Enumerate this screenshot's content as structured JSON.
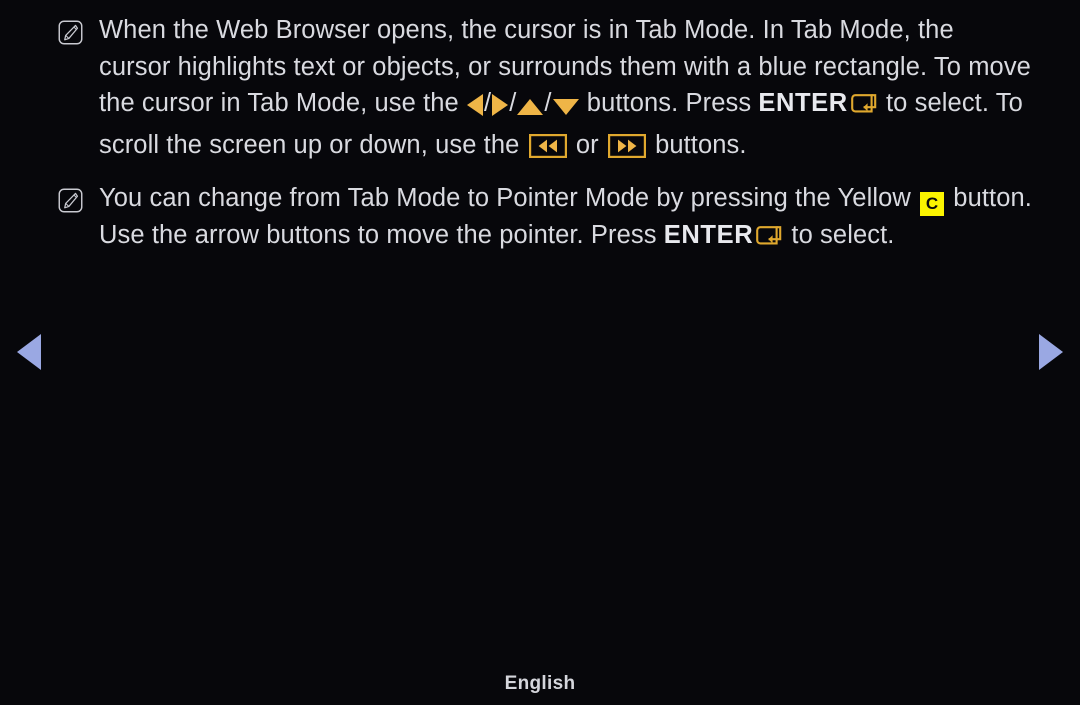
{
  "screen": {
    "background_color": "#07070b",
    "text_color": "#d9dae0",
    "accent_amber": "#efb547",
    "accent_yellow": "#fbf400",
    "nav_arrow_color": "#9aa8e3"
  },
  "notes": [
    {
      "icon": "note-pen-icon",
      "segments": [
        {
          "type": "text",
          "value": "When the Web Browser opens, the cursor is in Tab Mode. In Tab Mode, the cursor highlights text or objects, or surrounds them with a blue rectangle. To move the cursor in Tab Mode, use the "
        },
        {
          "type": "icon",
          "name": "arrow-left-icon"
        },
        {
          "type": "text",
          "value": " / "
        },
        {
          "type": "icon",
          "name": "arrow-right-icon"
        },
        {
          "type": "text",
          "value": " / "
        },
        {
          "type": "icon",
          "name": "arrow-up-icon"
        },
        {
          "type": "text",
          "value": " / "
        },
        {
          "type": "icon",
          "name": "arrow-down-icon"
        },
        {
          "type": "text",
          "value": " buttons. Press "
        },
        {
          "type": "strong",
          "value": "ENTER"
        },
        {
          "type": "icon",
          "name": "enter-key-icon"
        },
        {
          "type": "text",
          "value": " to select. To scroll the screen up or down, use the "
        },
        {
          "type": "icon",
          "name": "rewind-icon"
        },
        {
          "type": "text",
          "value": " or "
        },
        {
          "type": "icon",
          "name": "fast-forward-icon"
        },
        {
          "type": "text",
          "value": " buttons."
        }
      ]
    },
    {
      "icon": "note-pen-icon",
      "segments": [
        {
          "type": "text",
          "value": "You can change from Tab Mode to Pointer Mode by pressing the Yellow "
        },
        {
          "type": "icon",
          "name": "color-button-c-icon",
          "label": "C"
        },
        {
          "type": "text",
          "value": " button. Use the arrow buttons to move the pointer. Press "
        },
        {
          "type": "strong",
          "value": "ENTER"
        },
        {
          "type": "icon",
          "name": "enter-key-icon"
        },
        {
          "type": "text",
          "value": " to select."
        }
      ]
    }
  ],
  "note1": {
    "part1": "When the Web Browser opens, the cursor is in Tab Mode. In Tab Mode, the cursor highlights text or objects, or surrounds them with a blue rectangle. To move the cursor in Tab Mode, use the",
    "sep1": "/",
    "sep2": "/",
    "sep3": "/",
    "part2": "buttons. Press",
    "enter_label": "ENTER",
    "part3": "to select. To scroll the screen up or down, use the",
    "part4": "or",
    "part5": "buttons."
  },
  "note2": {
    "part1": "You can change from Tab Mode to Pointer Mode by pressing the Yellow",
    "color_button_label": "C",
    "part2": "button. Use the arrow buttons to move the pointer. Press",
    "enter_label": "ENTER",
    "part3": "to select."
  },
  "navigation": {
    "prev_label": "previous page",
    "next_label": "next page"
  },
  "footer": {
    "language": "English"
  }
}
